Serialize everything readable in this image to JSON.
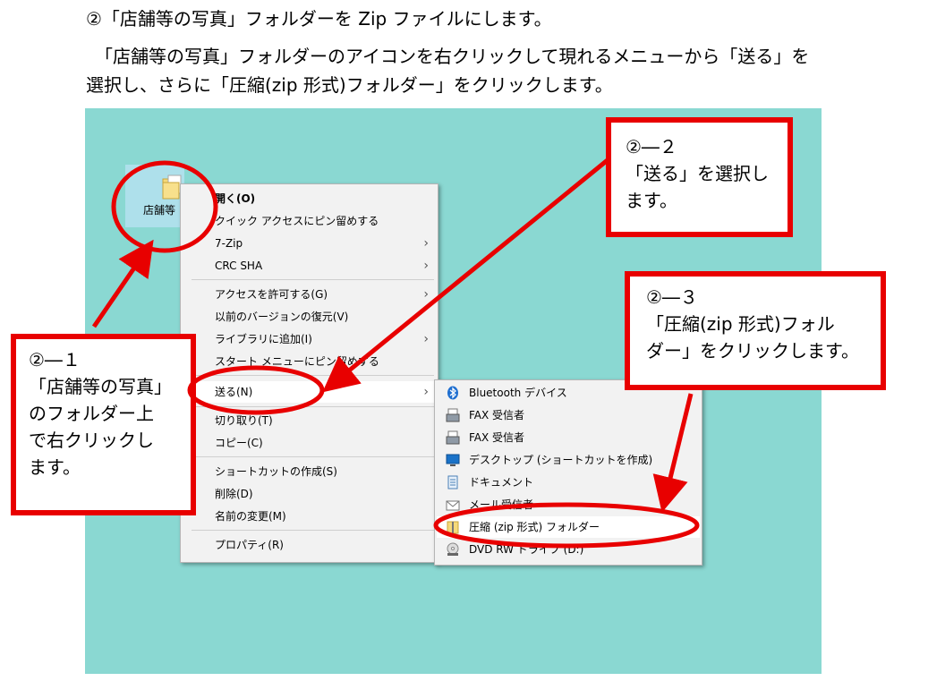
{
  "doc": {
    "line1": "②「店舗等の写真」フォルダーを Zip ファイルにします。",
    "line2": "　「店舗等の写真」フォルダーのアイコンを右クリックして現れるメニューから「送る」を",
    "line3": "選択し、さらに「圧縮(zip 形式)フォルダー」をクリックします。"
  },
  "desktop": {
    "folder_label": "店舗等"
  },
  "context_menu": {
    "items": [
      {
        "label": "開く(O)",
        "arrow": ""
      },
      {
        "label": "クイック アクセスにピン留めする",
        "arrow": ""
      },
      {
        "label": "7-Zip",
        "arrow": "›"
      },
      {
        "label": "CRC SHA",
        "arrow": "›"
      },
      {
        "label": "アクセスを許可する(G)",
        "arrow": "›"
      },
      {
        "label": "以前のバージョンの復元(V)",
        "arrow": ""
      },
      {
        "label": "ライブラリに追加(I)",
        "arrow": "›"
      },
      {
        "label": "スタート メニューにピン留めする",
        "arrow": ""
      },
      {
        "label": "送る(N)",
        "arrow": "›"
      },
      {
        "label": "切り取り(T)",
        "arrow": ""
      },
      {
        "label": "コピー(C)",
        "arrow": ""
      },
      {
        "label": "ショートカットの作成(S)",
        "arrow": ""
      },
      {
        "label": "削除(D)",
        "arrow": ""
      },
      {
        "label": "名前の変更(M)",
        "arrow": ""
      },
      {
        "label": "プロパティ(R)",
        "arrow": ""
      }
    ]
  },
  "send_to_menu": {
    "items": [
      {
        "label": "Bluetooth デバイス",
        "icon": "bluetooth-icon"
      },
      {
        "label": "FAX 受信者",
        "icon": "fax-icon"
      },
      {
        "label": "FAX 受信者",
        "icon": "fax-icon"
      },
      {
        "label": "デスクトップ (ショートカットを作成)",
        "icon": "desktop-icon"
      },
      {
        "label": "ドキュメント",
        "icon": "document-icon"
      },
      {
        "label": "メール受信者",
        "icon": "mail-icon"
      },
      {
        "label": "圧縮 (zip 形式) フォルダー",
        "icon": "zip-folder-icon"
      },
      {
        "label": "DVD RW ドライブ (D:)",
        "icon": "dvd-drive-icon"
      }
    ]
  },
  "callouts": {
    "c1": [
      "②―１",
      "「店舗等の写真」",
      "のフォルダー上",
      "で右クリックし",
      "ます。"
    ],
    "c2": [
      "②―２",
      "「送る」を選択し",
      "ます。"
    ],
    "c3": [
      "②―３",
      "「圧縮(zip 形式)フォル",
      "ダー」をクリックします。"
    ]
  },
  "colors": {
    "annotation_red": "#e80000",
    "desktop_bg": "#8ad8d2"
  }
}
